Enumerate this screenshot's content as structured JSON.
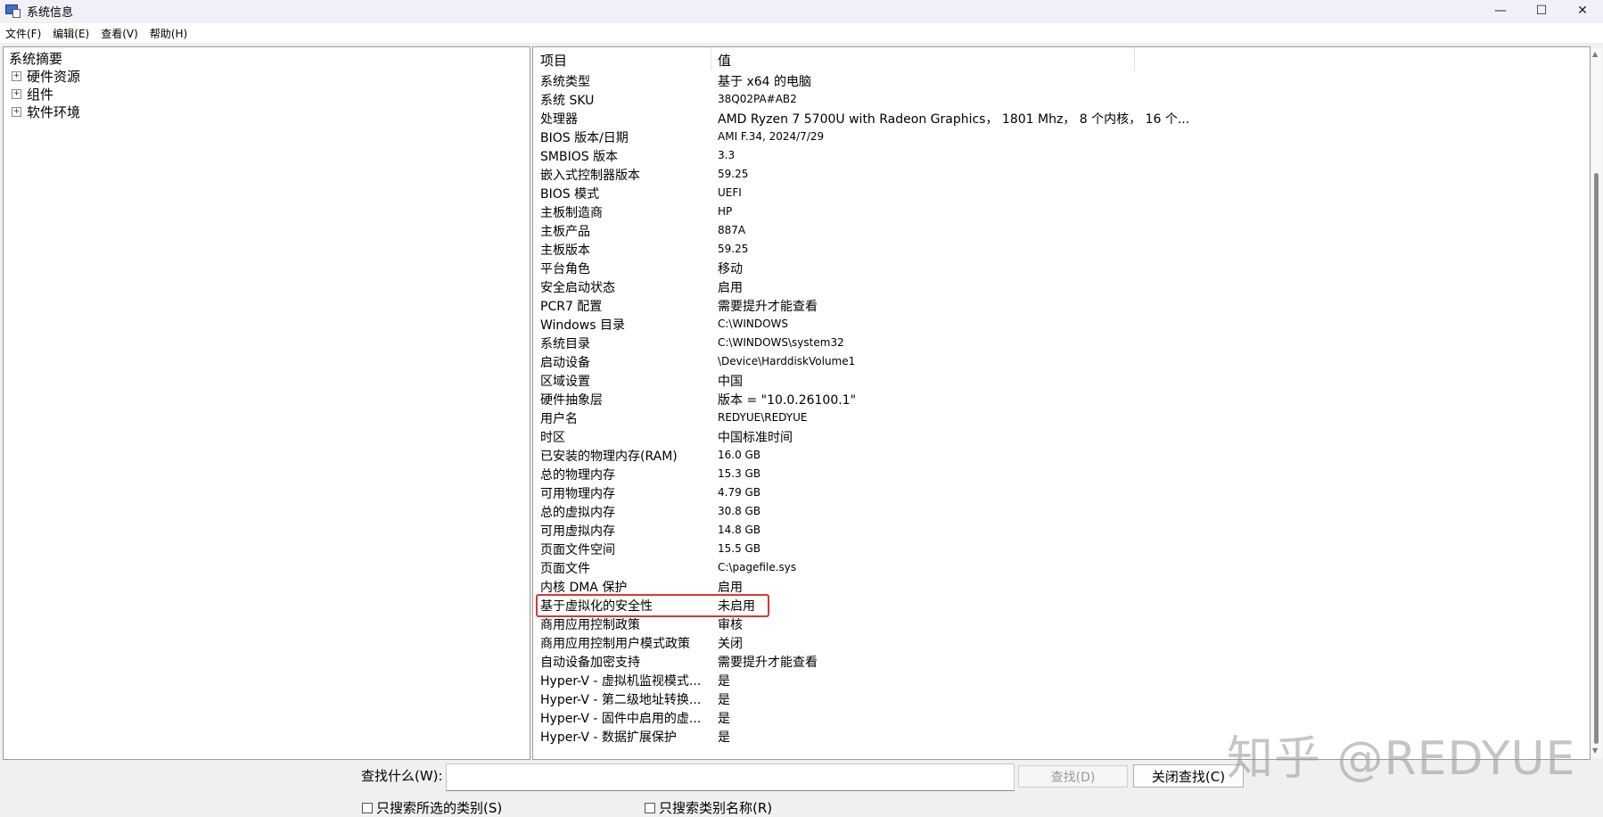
{
  "window": {
    "title": "系统信息",
    "controls": {
      "minimize": "—",
      "maximize": "☐",
      "close": "✕"
    }
  },
  "menu": [
    "文件(F)",
    "编辑(E)",
    "查看(V)",
    "帮助(H)"
  ],
  "tree": {
    "root": "系统摘要",
    "children": [
      "硬件资源",
      "组件",
      "软件环境"
    ],
    "expander": "+"
  },
  "table": {
    "headers": {
      "item": "项目",
      "value": "值"
    },
    "rows": [
      {
        "k": "系统类型",
        "v": "基于 x64 的电脑"
      },
      {
        "k": "系统 SKU",
        "v": "38Q02PA#AB2"
      },
      {
        "k": "处理器",
        "v": "AMD Ryzen 7 5700U with Radeon Graphics， 1801 Mhz， 8 个内核， 16 个..."
      },
      {
        "k": "BIOS 版本/日期",
        "v": "AMI F.34, 2024/7/29"
      },
      {
        "k": "SMBIOS 版本",
        "v": "3.3"
      },
      {
        "k": "嵌入式控制器版本",
        "v": "59.25"
      },
      {
        "k": "BIOS 模式",
        "v": "UEFI"
      },
      {
        "k": "主板制造商",
        "v": "HP"
      },
      {
        "k": "主板产品",
        "v": "887A"
      },
      {
        "k": "主板版本",
        "v": "59.25"
      },
      {
        "k": "平台角色",
        "v": "移动"
      },
      {
        "k": "安全启动状态",
        "v": "启用"
      },
      {
        "k": "PCR7 配置",
        "v": "需要提升才能查看"
      },
      {
        "k": "Windows 目录",
        "v": "C:\\WINDOWS"
      },
      {
        "k": "系统目录",
        "v": "C:\\WINDOWS\\system32"
      },
      {
        "k": "启动设备",
        "v": "\\Device\\HarddiskVolume1"
      },
      {
        "k": "区域设置",
        "v": "中国"
      },
      {
        "k": "硬件抽象层",
        "v": "版本 = \"10.0.26100.1\""
      },
      {
        "k": "用户名",
        "v": "REDYUE\\REDYUE"
      },
      {
        "k": "时区",
        "v": "中国标准时间"
      },
      {
        "k": "已安装的物理内存(RAM)",
        "v": "16.0 GB"
      },
      {
        "k": "总的物理内存",
        "v": "15.3 GB"
      },
      {
        "k": "可用物理内存",
        "v": "4.79 GB"
      },
      {
        "k": "总的虚拟内存",
        "v": "30.8 GB"
      },
      {
        "k": "可用虚拟内存",
        "v": "14.8 GB"
      },
      {
        "k": "页面文件空间",
        "v": "15.5 GB"
      },
      {
        "k": "页面文件",
        "v": "C:\\pagefile.sys"
      },
      {
        "k": "内核 DMA 保护",
        "v": "启用"
      },
      {
        "k": "基于虚拟化的安全性",
        "v": "未启用"
      },
      {
        "k": "商用应用控制政策",
        "v": "审核"
      },
      {
        "k": "商用应用控制用户模式政策",
        "v": "关闭"
      },
      {
        "k": "自动设备加密支持",
        "v": "需要提升才能查看"
      },
      {
        "k": "Hyper-V - 虚拟机监视模式...",
        "v": "是"
      },
      {
        "k": "Hyper-V - 第二级地址转换...",
        "v": "是"
      },
      {
        "k": "Hyper-V - 固件中启用的虚...",
        "v": "是"
      },
      {
        "k": "Hyper-V - 数据扩展保护",
        "v": "是"
      }
    ]
  },
  "find": {
    "label": "查找什么(W):",
    "input_value": "",
    "find_button": "查找(D)",
    "close_find_button": "关闭查找(C)",
    "checkbox_selected_category": "只搜索所选的类别(S)",
    "checkbox_category_names": "只搜索类别名称(R)"
  },
  "scrollbar": {
    "up": "▲",
    "down": "▼"
  },
  "watermark": "知乎 @REDYUE",
  "colors": {
    "highlight_border": "#e03434",
    "titlebar_bg": "#f3f0f9"
  }
}
